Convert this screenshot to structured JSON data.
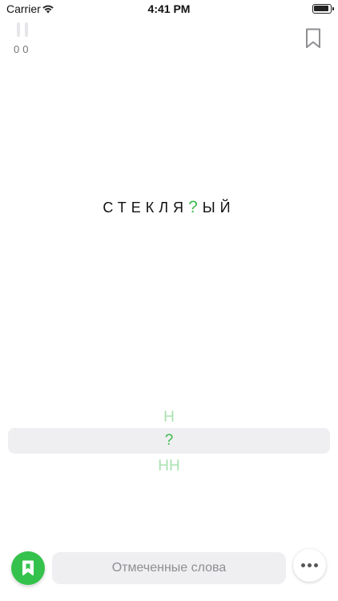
{
  "status_bar": {
    "carrier": "Carrier",
    "time": "4:41 PM",
    "wifi_icon": "wifi-icon",
    "battery_icon": "battery-icon"
  },
  "top_bar": {
    "pause_icon": "pause-icon",
    "score_correct": "0",
    "score_wrong": "0",
    "bookmark_icon": "bookmark-icon"
  },
  "word": {
    "prefix": "СТЕКЛЯ",
    "gap": "?",
    "suffix": "ЫЙ"
  },
  "picker": {
    "options": [
      "Н",
      "?",
      "НН"
    ],
    "selected_index": 1
  },
  "bottom_bar": {
    "fab_icon": "bookmark-icon",
    "marked_words_label": "Отмеченные слова",
    "more_icon": "more-icon"
  },
  "colors": {
    "accent": "#3dbb4c",
    "option_faded": "#a9e2b1",
    "fab": "#34c24c",
    "field_bg": "#efeff2"
  }
}
